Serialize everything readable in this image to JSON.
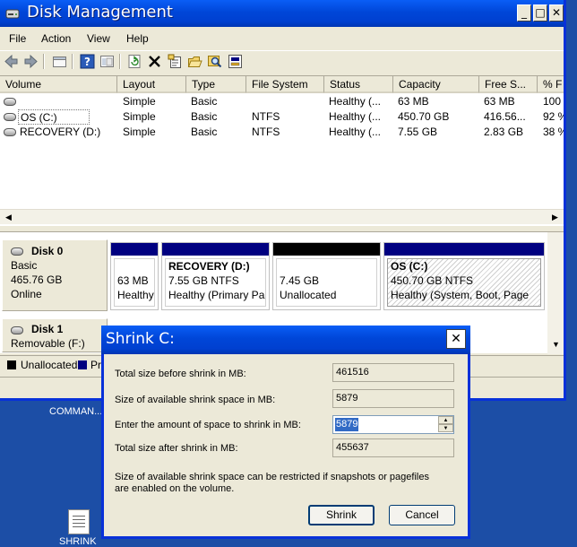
{
  "window": {
    "title": "Disk Management",
    "controls": {
      "minimize": "_",
      "maximize": "□",
      "close": "✕"
    }
  },
  "menu": [
    "File",
    "Action",
    "View",
    "Help"
  ],
  "toolbar": {
    "icons": [
      "back-icon",
      "forward-icon",
      "up-icon",
      "help-icon",
      "show-hide-icon",
      "refresh-icon",
      "delete-icon",
      "properties-icon",
      "open-icon",
      "explore-icon",
      "disk-settings-icon"
    ]
  },
  "volume_table": {
    "columns": [
      "Volume",
      "Layout",
      "Type",
      "File System",
      "Status",
      "Capacity",
      "Free S...",
      "% F"
    ],
    "rows": [
      {
        "volume": "",
        "layout": "Simple",
        "type": "Basic",
        "fs": "",
        "status": "Healthy (...",
        "capacity": "63 MB",
        "free": "63 MB",
        "pct": "100"
      },
      {
        "volume": "OS (C:)",
        "layout": "Simple",
        "type": "Basic",
        "fs": "NTFS",
        "status": "Healthy (...",
        "capacity": "450.70 GB",
        "free": "416.56...",
        "pct": "92 %"
      },
      {
        "volume": "RECOVERY (D:)",
        "layout": "Simple",
        "type": "Basic",
        "fs": "NTFS",
        "status": "Healthy (...",
        "capacity": "7.55 GB",
        "free": "2.83 GB",
        "pct": "38 %"
      }
    ]
  },
  "disks": [
    {
      "name": "Disk 0",
      "type": "Basic",
      "size": "465.76 GB",
      "state": "Online",
      "partitions": [
        {
          "title": "",
          "size": "63 MB",
          "status": "Healthy"
        },
        {
          "title": "RECOVERY  (D:)",
          "size": "7.55 GB NTFS",
          "status": "Healthy (Primary Pa"
        },
        {
          "title": "",
          "size": "7.45 GB",
          "status": "Unallocated"
        },
        {
          "title": "OS  (C:)",
          "size": "450.70 GB NTFS",
          "status": "Healthy (System, Boot, Page"
        }
      ]
    },
    {
      "name": "Disk 1",
      "type": "Removable (F:)"
    }
  ],
  "legend": [
    {
      "label": "Unallocated",
      "color": "#000000"
    },
    {
      "label": "Pri",
      "color": "#000080"
    }
  ],
  "colors": {
    "primary_partition": "#000080",
    "unallocated": "#000000",
    "title_bar": "#0046d8",
    "desktop": "#1c4ea6"
  },
  "desktop": {
    "labels": [
      "COMMAN...",
      "SHRINK"
    ]
  },
  "dialog": {
    "title": "Shrink C:",
    "close": "✕",
    "fields": [
      {
        "label": "Total size before shrink in MB:",
        "value": "461516"
      },
      {
        "label": "Size of available shrink space in MB:",
        "value": "5879"
      },
      {
        "label": "Enter the amount of space to shrink in MB:",
        "value": "5879"
      },
      {
        "label": "Total size after shrink in MB:",
        "value": "455637"
      }
    ],
    "note_line1": "Size of available shrink space can be restricted if snapshots or pagefiles",
    "note_line2": "are enabled on the volume.",
    "shrink_label": "Shrink",
    "cancel_label": "Cancel"
  }
}
